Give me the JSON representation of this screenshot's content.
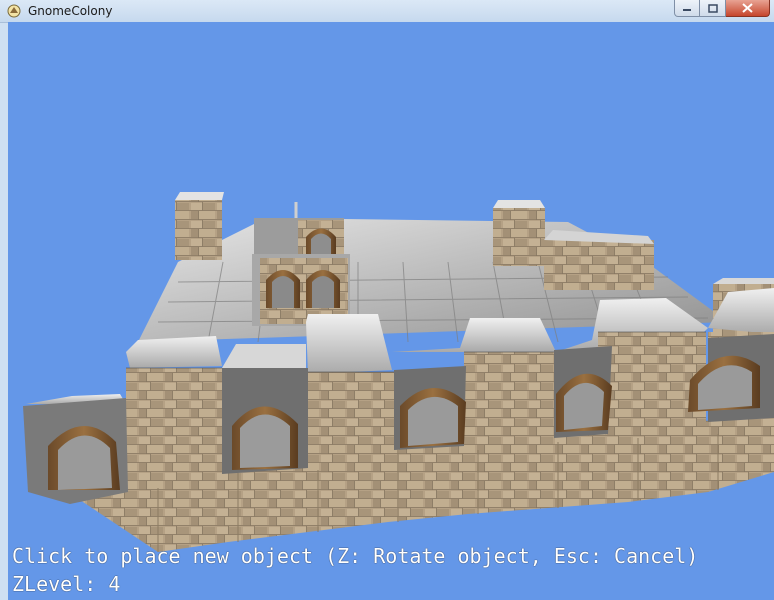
{
  "window": {
    "title": "GnomeColony",
    "controls": {
      "minimize_icon": "minimize-icon",
      "maximize_icon": "maximize-icon",
      "close_icon": "close-icon"
    }
  },
  "viewport": {
    "sky_color": "#6497e8",
    "stone_color": "#b8a48b",
    "top_color": "#d9d9d9"
  },
  "hud": {
    "instruction": "Click to place new object (Z: Rotate object, Esc: Cancel)",
    "zlevel": "ZLevel: 4"
  }
}
